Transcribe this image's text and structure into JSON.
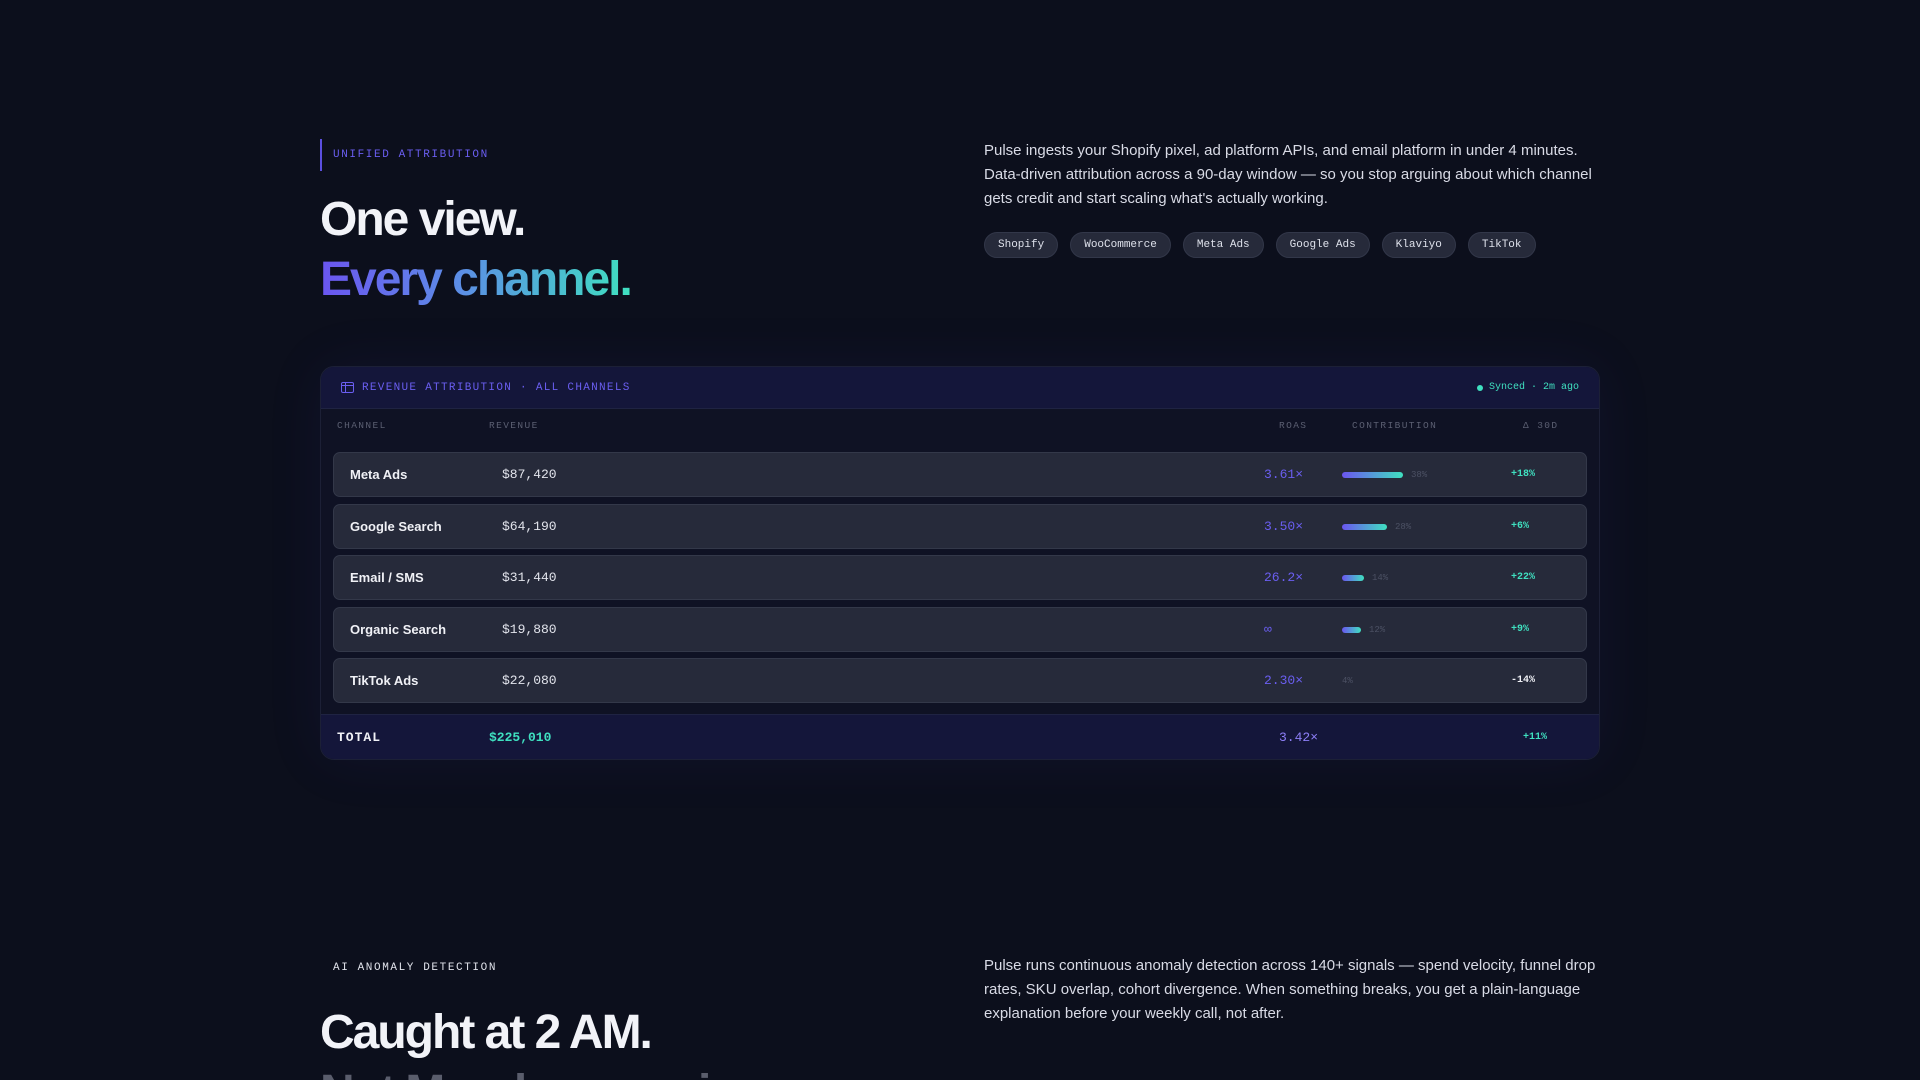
{
  "section1": {
    "eyebrow": "UNIFIED ATTRIBUTION",
    "title": "One view.",
    "title_gradient": "Every channel.",
    "description": "Pulse ingests your Shopify pixel, ad platform APIs, and email platform in under 4 minutes. Data-driven attribution across a 90-day window — so you stop arguing about which channel gets credit and start scaling what's actually working.",
    "chips": [
      "Shopify",
      "WooCommerce",
      "Meta Ads",
      "Google Ads",
      "Klaviyo",
      "TikTok"
    ]
  },
  "table": {
    "title": "REVENUE ATTRIBUTION · ALL CHANNELS",
    "sync_status": "Synced · 2m ago",
    "columns": {
      "channel": "CHANNEL",
      "revenue": "REVENUE",
      "roas": "ROAS",
      "contribution": "CONTRIBUTION",
      "delta": "Δ 30D"
    },
    "rows": [
      {
        "channel": "Meta Ads",
        "revenue": "$87,420",
        "roas": "3.61×",
        "contribution": "38%",
        "contribution_value": 0.38,
        "delta": "+18%",
        "delta_positive": true
      },
      {
        "channel": "Google Search",
        "revenue": "$64,190",
        "roas": "3.50×",
        "contribution": "28%",
        "contribution_value": 0.28,
        "delta": "+6%",
        "delta_positive": true
      },
      {
        "channel": "Email / SMS",
        "revenue": "$31,440",
        "roas": "26.2×",
        "contribution": "14%",
        "contribution_value": 0.14,
        "delta": "+22%",
        "delta_positive": true
      },
      {
        "channel": "Organic Search",
        "revenue": "$19,880",
        "roas": "∞",
        "contribution": "12%",
        "contribution_value": 0.12,
        "delta": "+9%",
        "delta_positive": true
      },
      {
        "channel": "TikTok Ads",
        "revenue": "$22,080",
        "roas": "2.30×",
        "contribution": "4%",
        "contribution_value": 0.04,
        "delta": "-14%",
        "delta_positive": false
      }
    ],
    "total": {
      "label": "TOTAL",
      "revenue": "$225,010",
      "roas": "3.42×",
      "delta": "+11%"
    }
  },
  "section2": {
    "eyebrow": "AI ANOMALY DETECTION",
    "title": "Caught at 2 AM.",
    "subtitle": "Not Monday morning.",
    "description": "Pulse runs continuous anomaly detection across 140+ signals — spend velocity, funnel drop rates, SKU overlap, cohort divergence. When something breaks, you get a plain-language explanation before your weekly call, not after."
  },
  "colors": {
    "background": "#0c0f1c",
    "accent_purple": "#6a5ef0",
    "accent_teal": "#3fe0c0",
    "row_background": "#262a3a"
  }
}
